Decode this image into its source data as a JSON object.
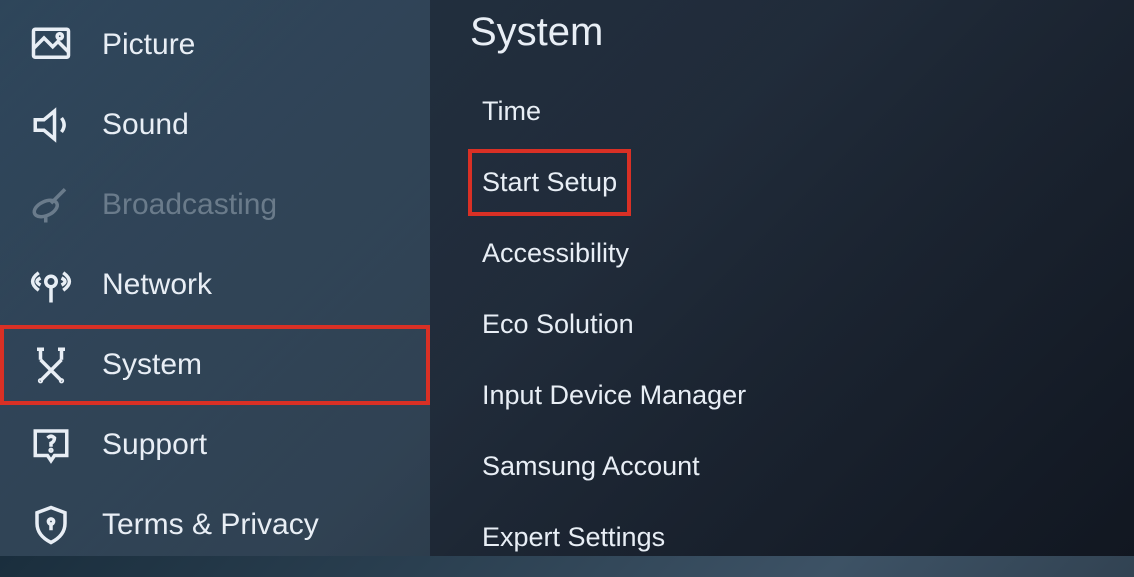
{
  "sidebar": {
    "items": [
      {
        "label": "Picture",
        "icon": "picture-icon",
        "disabled": false,
        "highlighted": false
      },
      {
        "label": "Sound",
        "icon": "sound-icon",
        "disabled": false,
        "highlighted": false
      },
      {
        "label": "Broadcasting",
        "icon": "broadcasting-icon",
        "disabled": true,
        "highlighted": false
      },
      {
        "label": "Network",
        "icon": "network-icon",
        "disabled": false,
        "highlighted": false
      },
      {
        "label": "System",
        "icon": "system-icon",
        "disabled": false,
        "highlighted": true
      },
      {
        "label": "Support",
        "icon": "support-icon",
        "disabled": false,
        "highlighted": false
      },
      {
        "label": "Terms & Privacy",
        "icon": "privacy-icon",
        "disabled": false,
        "highlighted": false
      }
    ]
  },
  "main": {
    "title": "System",
    "items": [
      {
        "label": "Time",
        "highlighted": false
      },
      {
        "label": "Start Setup",
        "highlighted": true
      },
      {
        "label": "Accessibility",
        "highlighted": false
      },
      {
        "label": "Eco Solution",
        "highlighted": false
      },
      {
        "label": "Input Device Manager",
        "highlighted": false
      },
      {
        "label": "Samsung Account",
        "highlighted": false
      },
      {
        "label": "Expert Settings",
        "highlighted": false
      }
    ]
  },
  "highlight_color": "#d93025"
}
